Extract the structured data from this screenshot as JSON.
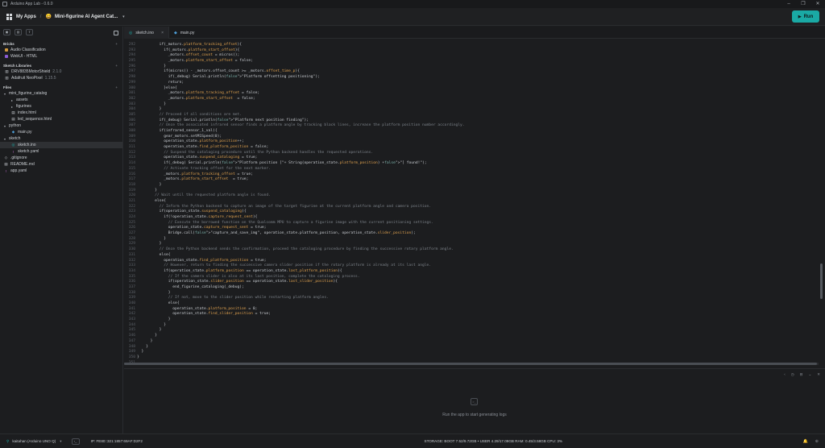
{
  "window": {
    "title": "Arduino App Lab - 0.6.0",
    "controls": [
      "–",
      "❐",
      "✕"
    ]
  },
  "topbar": {
    "my_apps": "My Apps",
    "separator": "/",
    "app_emoji": "😀",
    "app_name": "Mini-figurine AI Agent Cat...",
    "run_label": "Run"
  },
  "sidebar": {
    "bricks_title": "Bricks",
    "bricks": [
      {
        "label": "Audio Classification",
        "color": "#d29a3c"
      },
      {
        "label": "WebUI - HTML",
        "color": "#8a5bd3"
      }
    ],
    "libraries_title": "Sketch Libraries",
    "libraries": [
      {
        "label": "DRV8835MotorShield",
        "version": "2.1.0"
      },
      {
        "label": "Adafruit NeoPixel",
        "version": "1.15.5"
      }
    ],
    "files_title": "Files",
    "files": [
      {
        "label": "mini_figurine_catalog",
        "caret": "▾",
        "icon": "",
        "indent": 0,
        "color": "#c9cdd2"
      },
      {
        "label": "assets",
        "caret": "▸",
        "icon": "",
        "indent": 1,
        "color": "#c9cdd2"
      },
      {
        "label": "figurines",
        "caret": "▸",
        "icon": "",
        "indent": 1,
        "color": "#c9cdd2"
      },
      {
        "label": "index.html",
        "caret": "",
        "icon": "▤",
        "indent": 1,
        "color": "#c9cdd2"
      },
      {
        "label": "led_sequence.html",
        "caret": "",
        "icon": "▤",
        "indent": 1,
        "color": "#c9cdd2"
      },
      {
        "label": "python",
        "caret": "▾",
        "icon": "",
        "indent": 0,
        "color": "#c9cdd2"
      },
      {
        "label": "main.py",
        "caret": "",
        "icon": "◆",
        "indent": 1,
        "color": "#4e9fd8"
      },
      {
        "label": "sketch",
        "caret": "▾",
        "icon": "",
        "indent": 0,
        "color": "#c9cdd2"
      },
      {
        "label": "sketch.ino",
        "caret": "",
        "icon": "◎",
        "indent": 1,
        "color": "#1aa9a4",
        "active": true
      },
      {
        "label": "sketch.yaml",
        "caret": "",
        "icon": "!",
        "indent": 1,
        "color": "#c96fd6"
      },
      {
        "label": ".gitignore",
        "caret": "",
        "icon": "◇",
        "indent": 0,
        "color": "#c9cdd2"
      },
      {
        "label": "README.md",
        "caret": "",
        "icon": "▤",
        "indent": 0,
        "color": "#c9cdd2"
      },
      {
        "label": "app.yaml",
        "caret": "",
        "icon": "!",
        "indent": 0,
        "color": "#c96fd6"
      }
    ]
  },
  "tabs": [
    {
      "label": "sketch.ino",
      "active": true
    },
    {
      "label": "main.py",
      "active": false
    }
  ],
  "code_lines": [
    {
      "n": "292",
      "text": "          if(_motors.platform_tracking_offset){"
    },
    {
      "n": "293",
      "text": "            if(_motors.platform_start_offset){"
    },
    {
      "n": "294",
      "text": "              _motors.offset_count = micros();"
    },
    {
      "n": "295",
      "text": "              _motors.platform_start_offset = false;"
    },
    {
      "n": "296",
      "text": "            }"
    },
    {
      "n": "297",
      "text": "            if(micros() - _motors.offset_count >= _motors.offset_time_p){"
    },
    {
      "n": "298",
      "text": "              if(_debug) Serial.println(\"Platform offsetting positioning\");"
    },
    {
      "n": "299",
      "text": "              return;"
    },
    {
      "n": "300",
      "text": "            }else{"
    },
    {
      "n": "301",
      "text": "              _motors.platform_tracking_offset = false;"
    },
    {
      "n": "302",
      "text": "              _motors.platform_start_offset  = false;"
    },
    {
      "n": "303",
      "text": "            }"
    },
    {
      "n": "304",
      "text": "          }"
    },
    {
      "n": "305",
      "text": "          // Proceed if all conditions are met."
    },
    {
      "n": "306",
      "text": "          if(_debug) Serial.println(\"Platform next position finding\");"
    },
    {
      "n": "307",
      "text": "          // Once the associated infrared sensor finds a platform angle by tracking black lines, increase the platform position number accordingly."
    },
    {
      "n": "308",
      "text": "          if(infrared_sensor_1_val){"
    },
    {
      "n": "309",
      "text": "            gear_motors.setM1Speed(0);"
    },
    {
      "n": "310",
      "text": "            operation_state.platform_position++;"
    },
    {
      "n": "311",
      "text": "            operation_state.find_platform_position = false;"
    },
    {
      "n": "312",
      "text": "            // Suspend the cataloging procedure until the Python backend handles the requested operations."
    },
    {
      "n": "313",
      "text": "            operation_state.suspend_cataloging = true;"
    },
    {
      "n": "314",
      "text": "            if(_debug) Serial.println(\"Platform position [\"+ String(operation_state.platform_position) +\"] found!\");"
    },
    {
      "n": "315",
      "text": "            // Activate tracking offset for the next marker."
    },
    {
      "n": "316",
      "text": "            _motors.platform_tracking_offset = true;"
    },
    {
      "n": "317",
      "text": "            _motors.platform_start_offset  = true;"
    },
    {
      "n": "318",
      "text": "          }"
    },
    {
      "n": "319",
      "text": "        }"
    },
    {
      "n": "320",
      "text": "        // Wait until the requested platform angle is found."
    },
    {
      "n": "321",
      "text": "        else{"
    },
    {
      "n": "322",
      "text": "          // Inform the Python backend to capture an image of the target figurine at the current platform angle and camera position."
    },
    {
      "n": "323",
      "text": "          if(operation_state.suspend_cataloging){"
    },
    {
      "n": "324",
      "text": "            if(!operation_state.capture_request_sent){"
    },
    {
      "n": "325",
      "text": "              // Execute the borrowed function on the Qualcomm MPU to capture a figurine image with the current positioning settings."
    },
    {
      "n": "326",
      "text": "              operation_state.capture_request_sent = true;"
    },
    {
      "n": "327",
      "text": "              Bridge.call(\"capture_and_save_img\", operation_state.platform_position, operation_state.slider_position);"
    },
    {
      "n": "328",
      "text": "            }"
    },
    {
      "n": "329",
      "text": "          }"
    },
    {
      "n": "330",
      "text": "          // Once the Python backend sends the confirmation, proceed the cataloging procedure by finding the successive rotary platform angle."
    },
    {
      "n": "331",
      "text": "          else{"
    },
    {
      "n": "332",
      "text": "            operation_state.find_platform_position = true;"
    },
    {
      "n": "333",
      "text": "            // However, return to finding the successive camera slider position if the rotary platform is already at its last angle."
    },
    {
      "n": "334",
      "text": "            if(operation_state.platform_position == operation_state.last_platform_position){"
    },
    {
      "n": "335",
      "text": "              // If the camera slider is also at its last position, complete the cataloging process."
    },
    {
      "n": "336",
      "text": "              if(operation_state.slider_position == operation_state.last_slider_position){"
    },
    {
      "n": "337",
      "text": "                end_figurine_cataloging(_debug);"
    },
    {
      "n": "338",
      "text": "              }"
    },
    {
      "n": "339",
      "text": "              // If not, move to the slider position while restarting platform angles."
    },
    {
      "n": "340",
      "text": "              else{"
    },
    {
      "n": "341",
      "text": "                operation_state.platform_position = 0;"
    },
    {
      "n": "342",
      "text": "                operation_state.find_slider_position = true;"
    },
    {
      "n": "343",
      "text": "              }"
    },
    {
      "n": "344",
      "text": "            }"
    },
    {
      "n": "345",
      "text": "          }"
    },
    {
      "n": "346",
      "text": "        }"
    },
    {
      "n": "347",
      "text": "      }"
    },
    {
      "n": "348",
      "text": "    }"
    },
    {
      "n": "349",
      "text": "  }"
    },
    {
      "n": "350",
      "text": "}"
    },
    {
      "n": "351",
      "text": ""
    }
  ],
  "console": {
    "message": "Run the app to start generating logs",
    "tools": [
      "‹",
      "◷",
      "⊟",
      "⌄",
      "✕"
    ]
  },
  "statusbar": {
    "board": "kaitahan (Arduino UNO Q)",
    "ip": "IP: FE80::321:1857:69AF:D2F2",
    "stats": "STORAGE: BOOT 7.52/9.72GB • USER 4.29/17.09GB   RAM: 0.45/3.58GB   CPU: 3%",
    "right_icons": [
      "🔔",
      "⊕"
    ]
  },
  "colors": {
    "accent": "#1aa9a4",
    "background": "#1c1d1f"
  }
}
